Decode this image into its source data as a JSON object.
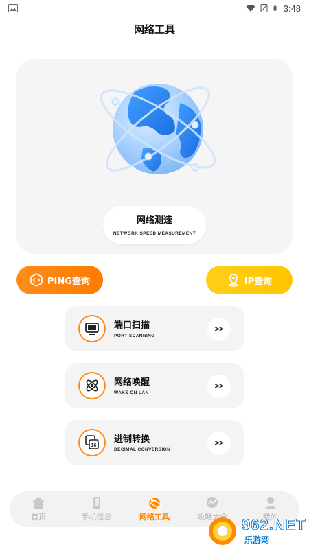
{
  "status_bar": {
    "time": "3:48",
    "icons": [
      "image-icon",
      "wifi-icon",
      "sim-icon",
      "battery-icon"
    ]
  },
  "page": {
    "title": "网络工具"
  },
  "hero": {
    "title": "网络测速",
    "subtitle": "NETWORK SPEED MEASUREMENT",
    "icon": "globe-icon"
  },
  "quick_actions": {
    "ping_label": "PING查询",
    "ip_label": "IP查询",
    "ping_color": "#ff8a00",
    "ip_color": "#ffc800"
  },
  "tools": [
    {
      "title": "端口扫描",
      "subtitle": "PORT SCANNING",
      "icon": "monitor-icon",
      "arrow": ">>"
    },
    {
      "title": "网络唤醒",
      "subtitle": "WAKE ON LAN",
      "icon": "atom-icon",
      "arrow": ">>"
    },
    {
      "title": "进制转换",
      "subtitle": "DECIMAL CONVERSION",
      "icon": "conversion-icon",
      "arrow": ">>"
    }
  ],
  "bottom_nav": {
    "items": [
      {
        "label": "首页",
        "icon": "home-icon",
        "active": false
      },
      {
        "label": "手机信息",
        "icon": "phone-icon",
        "active": false
      },
      {
        "label": "网络工具",
        "icon": "network-icon",
        "active": true
      },
      {
        "label": "攻略大全",
        "icon": "chat-icon",
        "active": false
      },
      {
        "label": "我的",
        "icon": "user-icon",
        "active": false
      }
    ]
  },
  "watermark": {
    "text": "962.NET",
    "sub": "乐游网"
  },
  "colors": {
    "accent": "#ff8a00",
    "secondary": "#ffc800",
    "card_bg": "#f5f5f5"
  }
}
